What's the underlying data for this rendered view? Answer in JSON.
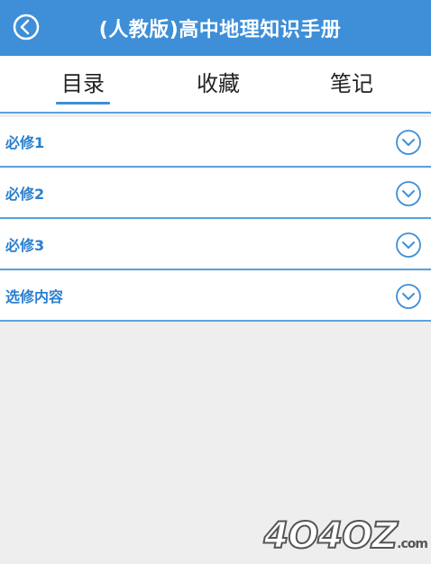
{
  "header": {
    "title": "(人教版)高中地理知识手册"
  },
  "tabs": [
    {
      "label": "目录",
      "active": true
    },
    {
      "label": "收藏",
      "active": false
    },
    {
      "label": "笔记",
      "active": false
    }
  ],
  "list": [
    {
      "label": "必修1"
    },
    {
      "label": "必修2"
    },
    {
      "label": "必修3"
    },
    {
      "label": "选修内容"
    }
  ],
  "watermark": {
    "text": "4O4OZ",
    "suffix": ".com"
  },
  "colors": {
    "accent": "#3e8fd8",
    "divider": "#5aa3e0",
    "item_text": "#2a7fcf",
    "background": "#eeeeee"
  }
}
